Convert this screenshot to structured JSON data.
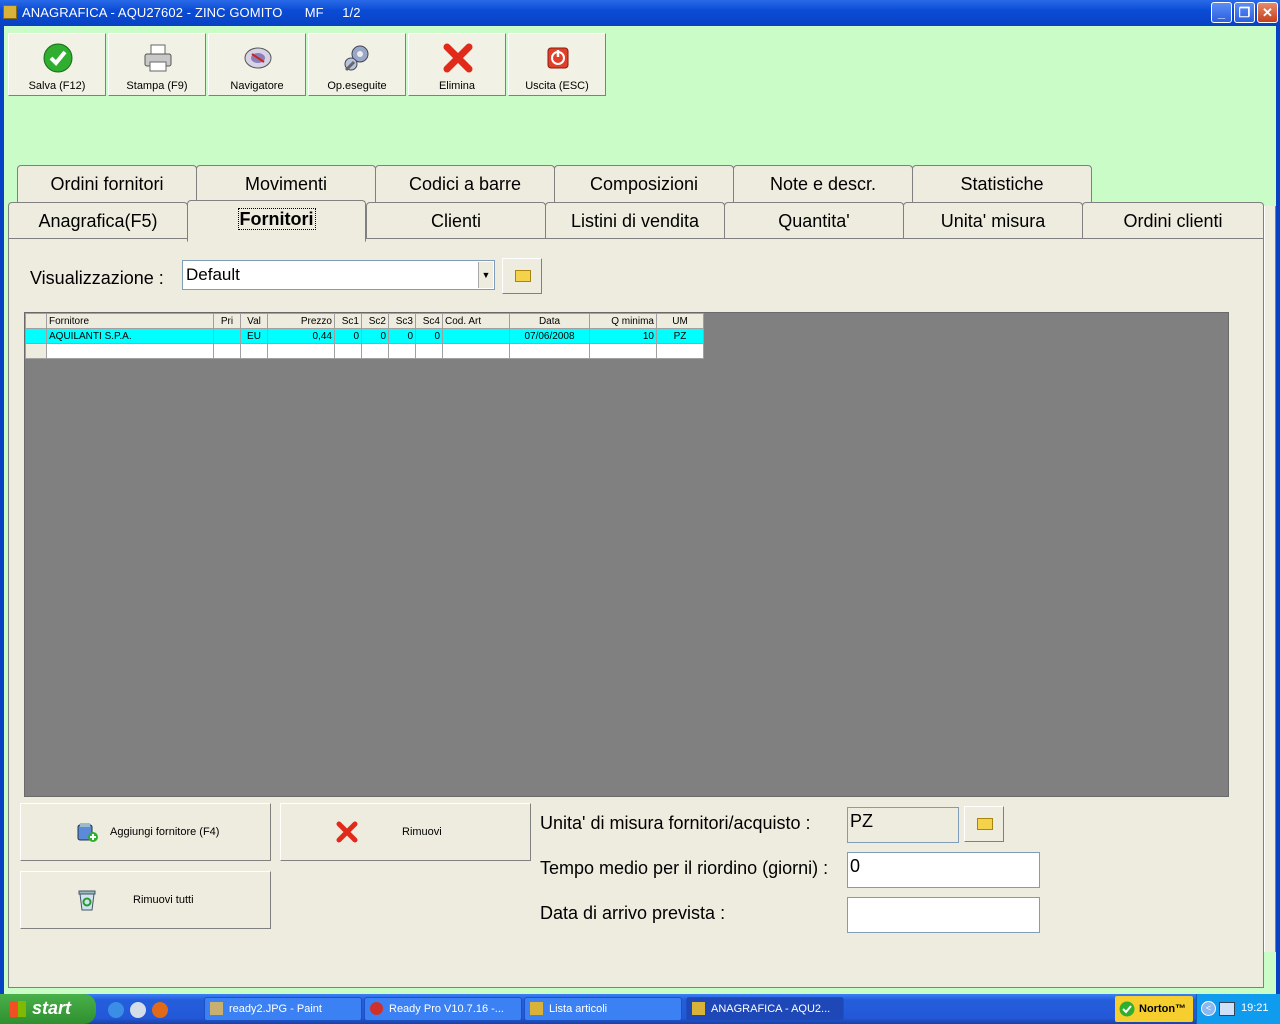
{
  "window": {
    "title": "ANAGRAFICA - AQU27602 - ZINC GOMITO      MF     1/2",
    "buttons": {
      "minimize": "_",
      "restore": "❐",
      "close": "✕"
    }
  },
  "toolbar": [
    {
      "label": "Salva (F12)",
      "icon": "check-icon"
    },
    {
      "label": "Stampa (F9)",
      "icon": "printer-icon"
    },
    {
      "label": "Navigatore",
      "icon": "navigator-icon"
    },
    {
      "label": "Op.eseguite",
      "icon": "gears-icon"
    },
    {
      "label": "Elimina",
      "icon": "delete-x-icon"
    },
    {
      "label": "Uscita (ESC)",
      "icon": "power-icon"
    }
  ],
  "tabs_back": [
    "Ordini fornitori",
    "Movimenti",
    "Codici a barre",
    "Composizioni",
    "Note e descr.",
    "Statistiche"
  ],
  "tabs_front": [
    "Anagrafica(F5)",
    "Fornitori",
    "Clienti",
    "Listini di vendita",
    "Quantita'",
    "Unita' misura",
    "Ordini clienti"
  ],
  "active_tab": "Fornitori",
  "view": {
    "label": "Visualizzazione :",
    "value": "Default"
  },
  "grid": {
    "columns": [
      "Fornitore",
      "Pri",
      "Val",
      "Prezzo",
      "Sc1",
      "Sc2",
      "Sc3",
      "Sc4",
      "Cod. Art",
      "Data",
      "Q minima",
      "UM"
    ],
    "rows": [
      [
        "AQUILANTI S.P.A.",
        "",
        "EU",
        "0,44",
        "0",
        "0",
        "0",
        "0",
        "",
        "07/06/2008",
        "10",
        "PZ"
      ],
      [
        "",
        "",
        "",
        "",
        "",
        "",
        "",
        "",
        "",
        "",
        "",
        ""
      ]
    ]
  },
  "actions": {
    "add": "Aggiungi fornitore (F4)",
    "remove": "Rimuovi",
    "remove_all": "Rimuovi tutti"
  },
  "fields": {
    "unit_label": "Unita' di misura fornitori/acquisto :",
    "unit_value": "PZ",
    "reorder_label": "Tempo medio per il riordino (giorni) :",
    "reorder_value": "0",
    "arrival_label": "Data di arrivo prevista :",
    "arrival_value": ""
  },
  "taskbar": {
    "start": "start",
    "tasks": [
      "ready2.JPG - Paint",
      "Ready Pro V10.7.16 -...",
      "Lista articoli",
      "ANAGRAFICA - AQU2..."
    ],
    "norton": "Norton™",
    "clock": "19:21"
  }
}
